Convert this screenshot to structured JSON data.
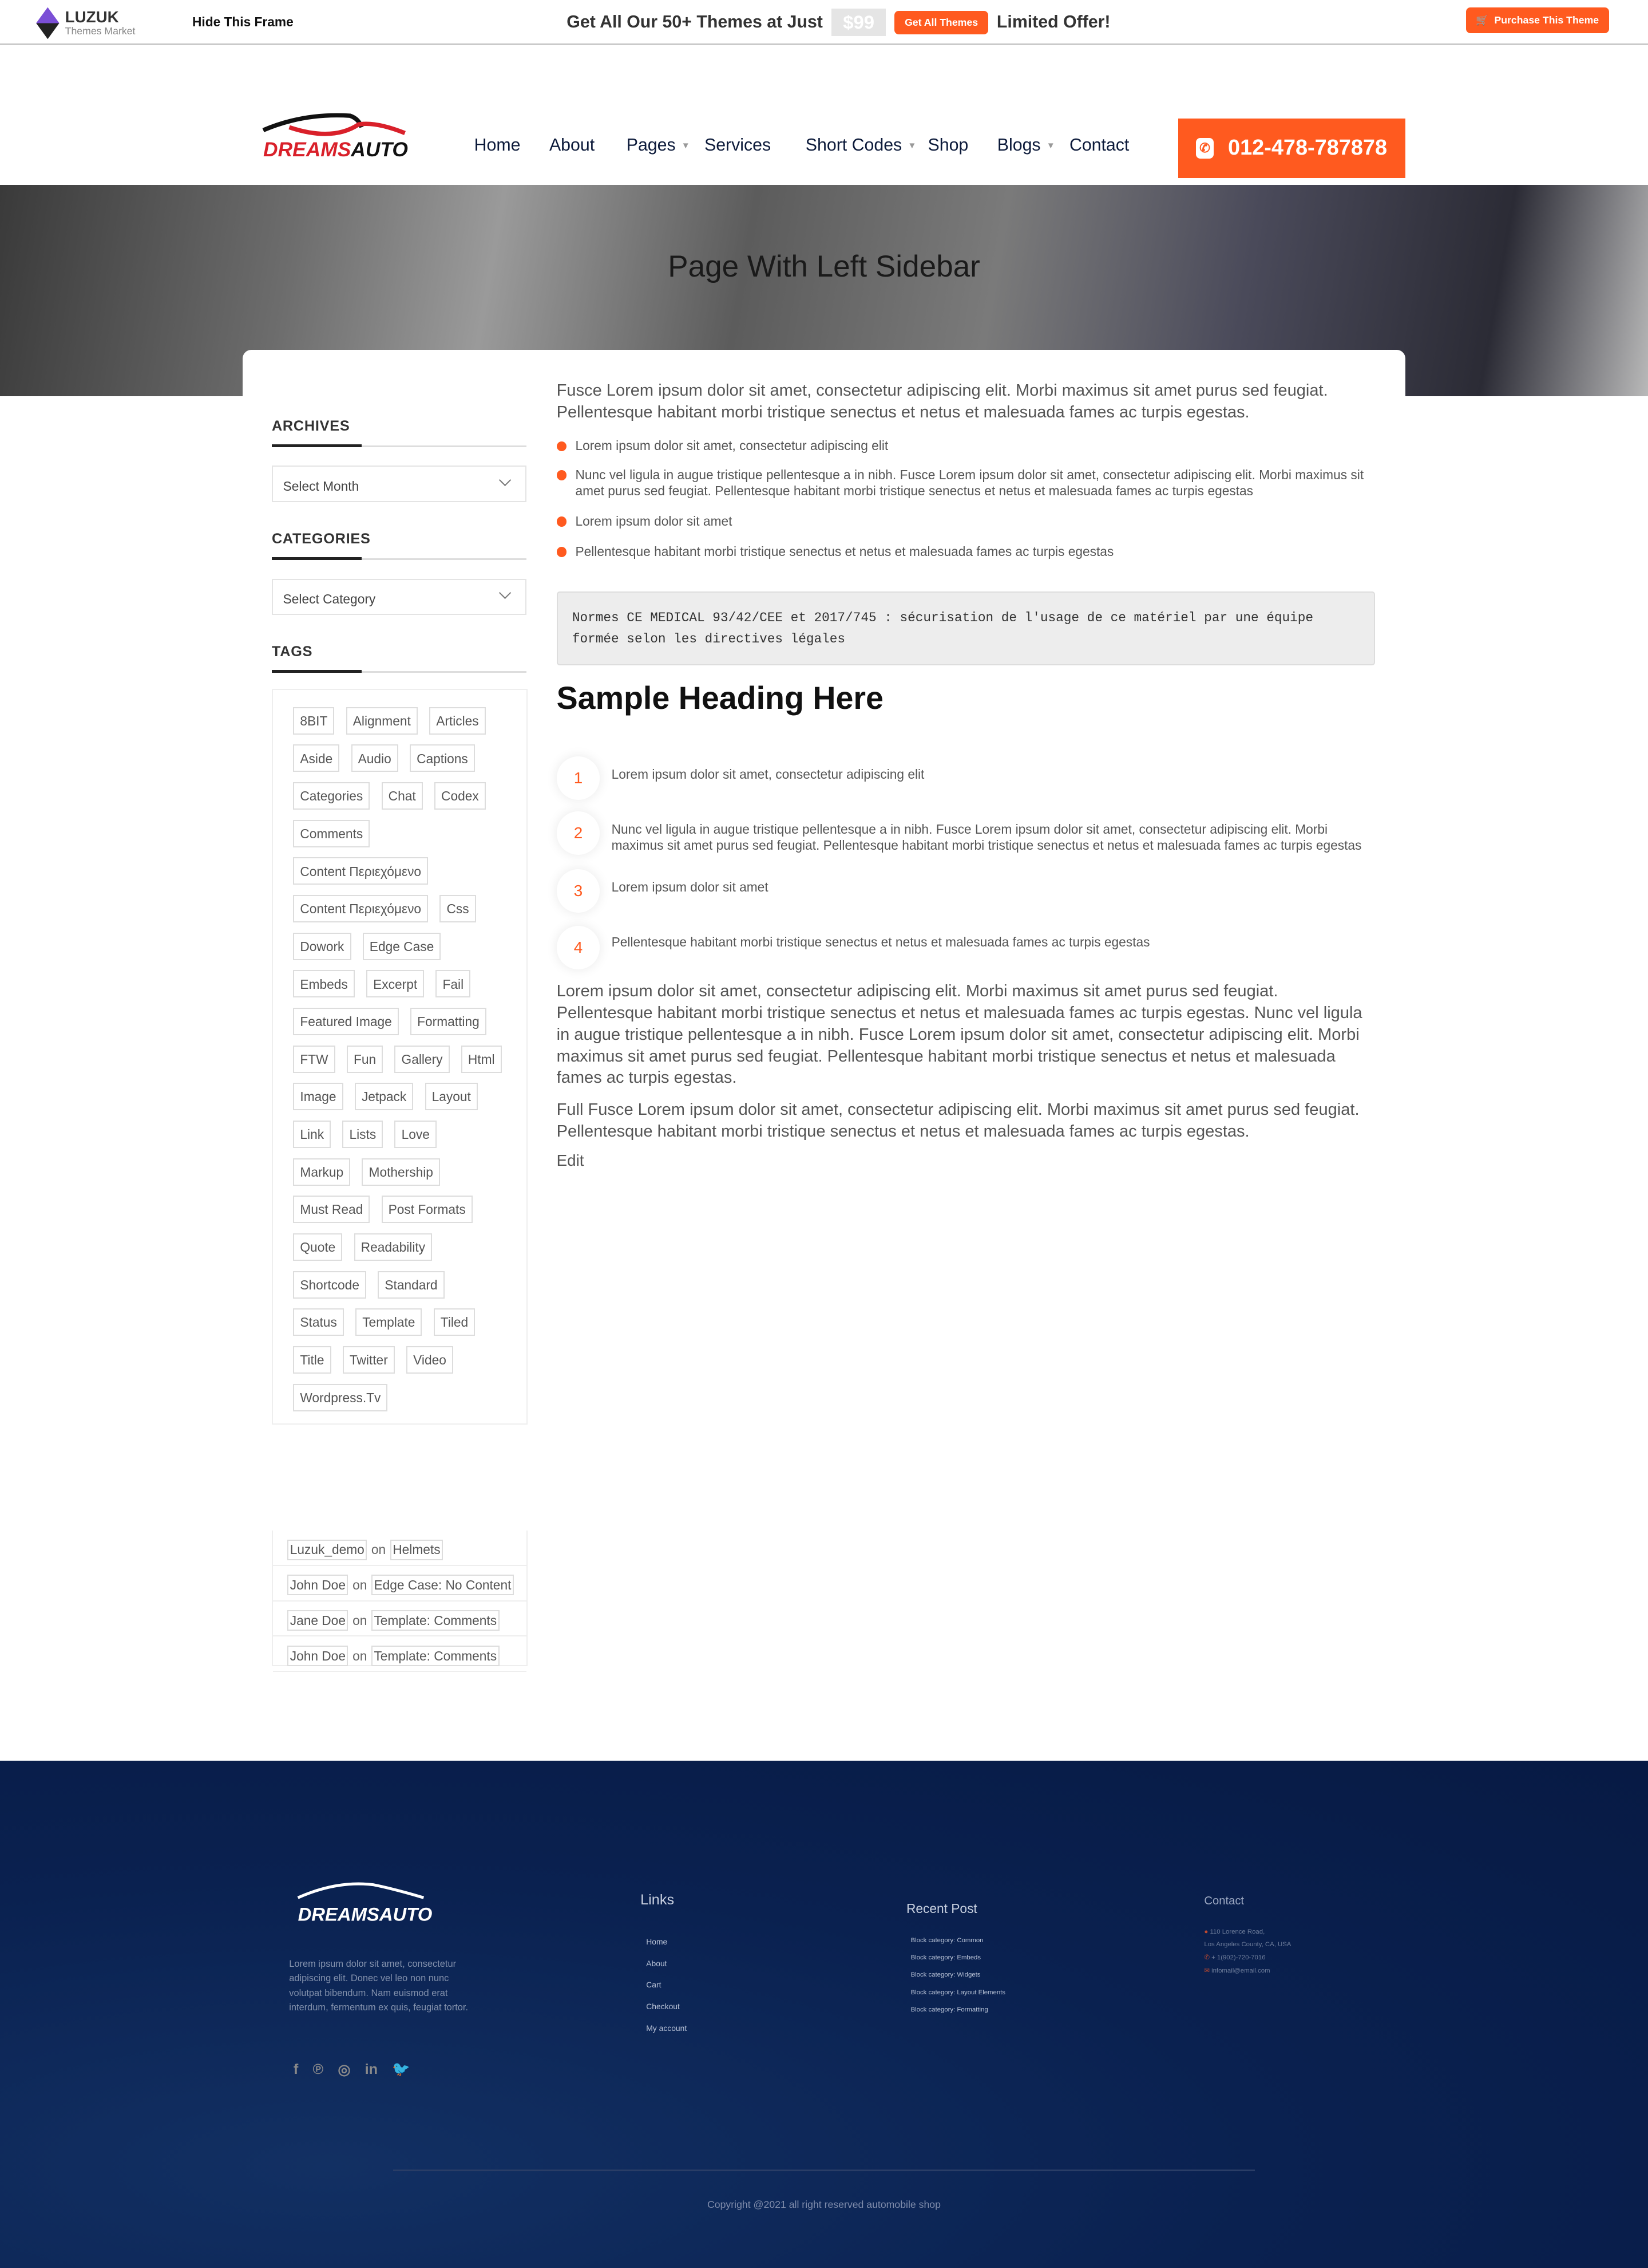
{
  "topbar": {
    "brand": "LUZUK",
    "brand_sub": "Themes Market",
    "hide_frame": "Hide This Frame",
    "promo_text": "Get All Our 50+ Themes at Just",
    "price": "$99",
    "get_all": "Get All Themes",
    "limited": "Limited Offer!",
    "purchase": "Purchase This Theme"
  },
  "header": {
    "logo_text": "DREAMSAUTO",
    "nav": [
      {
        "label": "Home"
      },
      {
        "label": "About"
      },
      {
        "label": "Pages",
        "dropdown": true
      },
      {
        "label": "Services"
      },
      {
        "label": "Short Codes",
        "dropdown": true
      },
      {
        "label": "Shop"
      },
      {
        "label": "Blogs",
        "dropdown": true
      },
      {
        "label": "Contact"
      }
    ],
    "phone": "012-478-787878"
  },
  "hero": {
    "title": "Page With Left Sidebar"
  },
  "sidebar": {
    "archives_title": "ARCHIVES",
    "archives_select": "Select Month",
    "categories_title": "CATEGORIES",
    "categories_select": "Select Category",
    "tags_title": "TAGS",
    "tags": [
      "8BIT",
      "Alignment",
      "Articles",
      "Aside",
      "Audio",
      "Captions",
      "Categories",
      "Chat",
      "Codex",
      "Comments",
      "Content Περιεχόμενο",
      "Content Περιεχόμενο",
      "Css",
      "Dowork",
      "Edge Case",
      "Embeds",
      "Excerpt",
      "Fail",
      "Featured Image",
      "Formatting",
      "FTW",
      "Fun",
      "Gallery",
      "Html",
      "Image",
      "Jetpack",
      "Layout",
      "Link",
      "Lists",
      "Love",
      "Markup",
      "Mothership",
      "Must Read",
      "Post Formats",
      "Quote",
      "Readability",
      "Shortcode",
      "Standard",
      "Status",
      "Template",
      "Tiled",
      "Title",
      "Twitter",
      "Video",
      "Wordpress.Tv"
    ],
    "comments": [
      {
        "author": "Luzuk_demo",
        "on": "on",
        "post": "Helmets"
      },
      {
        "author": "John Doe",
        "on": "on",
        "post": "Edge Case: No Content"
      },
      {
        "author": "Jane Doe",
        "on": "on",
        "post": "Template: Comments"
      },
      {
        "author": "John Doe",
        "on": "on",
        "post": "Template: Comments"
      }
    ]
  },
  "content": {
    "intro": "Fusce Lorem ipsum dolor sit amet, consectetur adipiscing elit. Morbi maximus sit amet purus sed feugiat. Pellentesque habitant morbi tristique senectus et netus et malesuada fames ac turpis egestas.",
    "bullets": [
      "Lorem ipsum dolor sit amet, consectetur adipiscing elit",
      "Nunc vel ligula in augue tristique pellentesque a in nibh. Fusce Lorem ipsum dolor sit amet, consectetur adipiscing elit. Morbi maximus sit amet purus sed feugiat. Pellentesque habitant morbi tristique senectus et netus et malesuada fames ac turpis egestas",
      "Lorem ipsum dolor sit amet",
      "Pellentesque habitant morbi tristique senectus et netus et malesuada fames ac turpis egestas"
    ],
    "code": "Normes CE MEDICAL 93/42/CEE et 2017/745 : sécurisation de l'usage de ce matériel par une équipe formée selon les directives légales",
    "heading": "Sample Heading Here",
    "numbered": [
      {
        "n": "1",
        "text": "Lorem ipsum dolor sit amet, consectetur adipiscing elit"
      },
      {
        "n": "2",
        "text": "Nunc vel ligula in augue tristique pellentesque a in nibh. Fusce Lorem ipsum dolor sit amet, consectetur adipiscing elit. Morbi maximus sit amet purus sed feugiat. Pellentesque habitant morbi tristique senectus et netus et malesuada fames ac turpis egestas"
      },
      {
        "n": "3",
        "text": "Lorem ipsum dolor sit amet"
      },
      {
        "n": "4",
        "text": "Pellentesque habitant morbi tristique senectus et netus et malesuada fames ac turpis egestas"
      }
    ],
    "para1": "Lorem ipsum dolor sit amet, consectetur adipiscing elit. Morbi maximus sit amet purus sed feugiat. Pellentesque habitant morbi tristique senectus et netus et malesuada fames ac turpis egestas. Nunc vel ligula in augue tristique pellentesque a in nibh. Fusce Lorem ipsum dolor sit amet, consectetur adipiscing elit. Morbi maximus sit amet purus sed feugiat. Pellentesque habitant morbi tristique senectus et netus et malesuada fames ac turpis egestas.",
    "para2": "Full Fusce Lorem ipsum dolor sit amet, consectetur adipiscing elit. Morbi maximus sit amet purus sed feugiat. Pellentesque habitant morbi tristique senectus et netus et malesuada fames ac turpis egestas.",
    "edit": "Edit"
  },
  "footer": {
    "logo_text": "DREAMSAUTO",
    "desc": "Lorem ipsum dolor sit amet, consectetur adipiscing elit. Donec vel leo non nunc volutpat bibendum. Nam euismod erat interdum, fermentum ex quis, feugiat tortor.",
    "social": [
      "facebook-icon",
      "pinterest-icon",
      "instagram-icon",
      "linkedin-icon",
      "twitter-icon"
    ],
    "links_title": "Links",
    "links": [
      "Home",
      "About",
      "Cart",
      "Checkout",
      "My account"
    ],
    "recent_title": "Recent Post",
    "recent": [
      "Block category: Common",
      "Block category: Embeds",
      "Block category: Widgets",
      "Block category: Layout Elements",
      "Block category: Formatting"
    ],
    "contact_title": "Contact",
    "address1": "110 Lorence Road,",
    "address2": "Los Angeles County, CA, USA",
    "phone": "+ 1(902)-720-7016",
    "email": "infomail@email.com",
    "copyright": "Copyright @2021 all right reserved automobile shop"
  },
  "colors": {
    "accent": "#ff5a1f",
    "footer_bg": "#0a2150",
    "nav_text": "#0c1a3a"
  }
}
